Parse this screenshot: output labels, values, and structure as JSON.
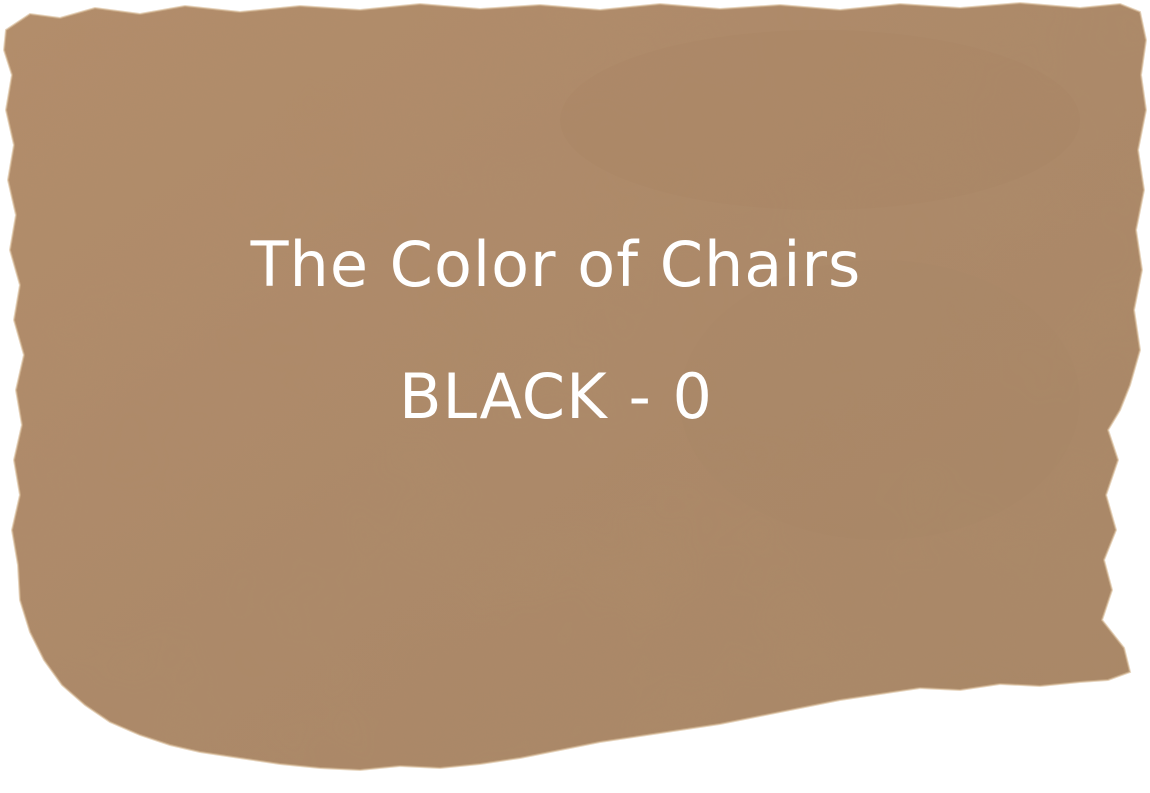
{
  "card": {
    "title": "The Color of Chairs",
    "subtitle": "BLACK - 0"
  },
  "colors": {
    "paper_base": "#b08a68",
    "paper_light": "#c29a74",
    "paper_dark": "#8f6e52",
    "text": "#ffffff"
  }
}
